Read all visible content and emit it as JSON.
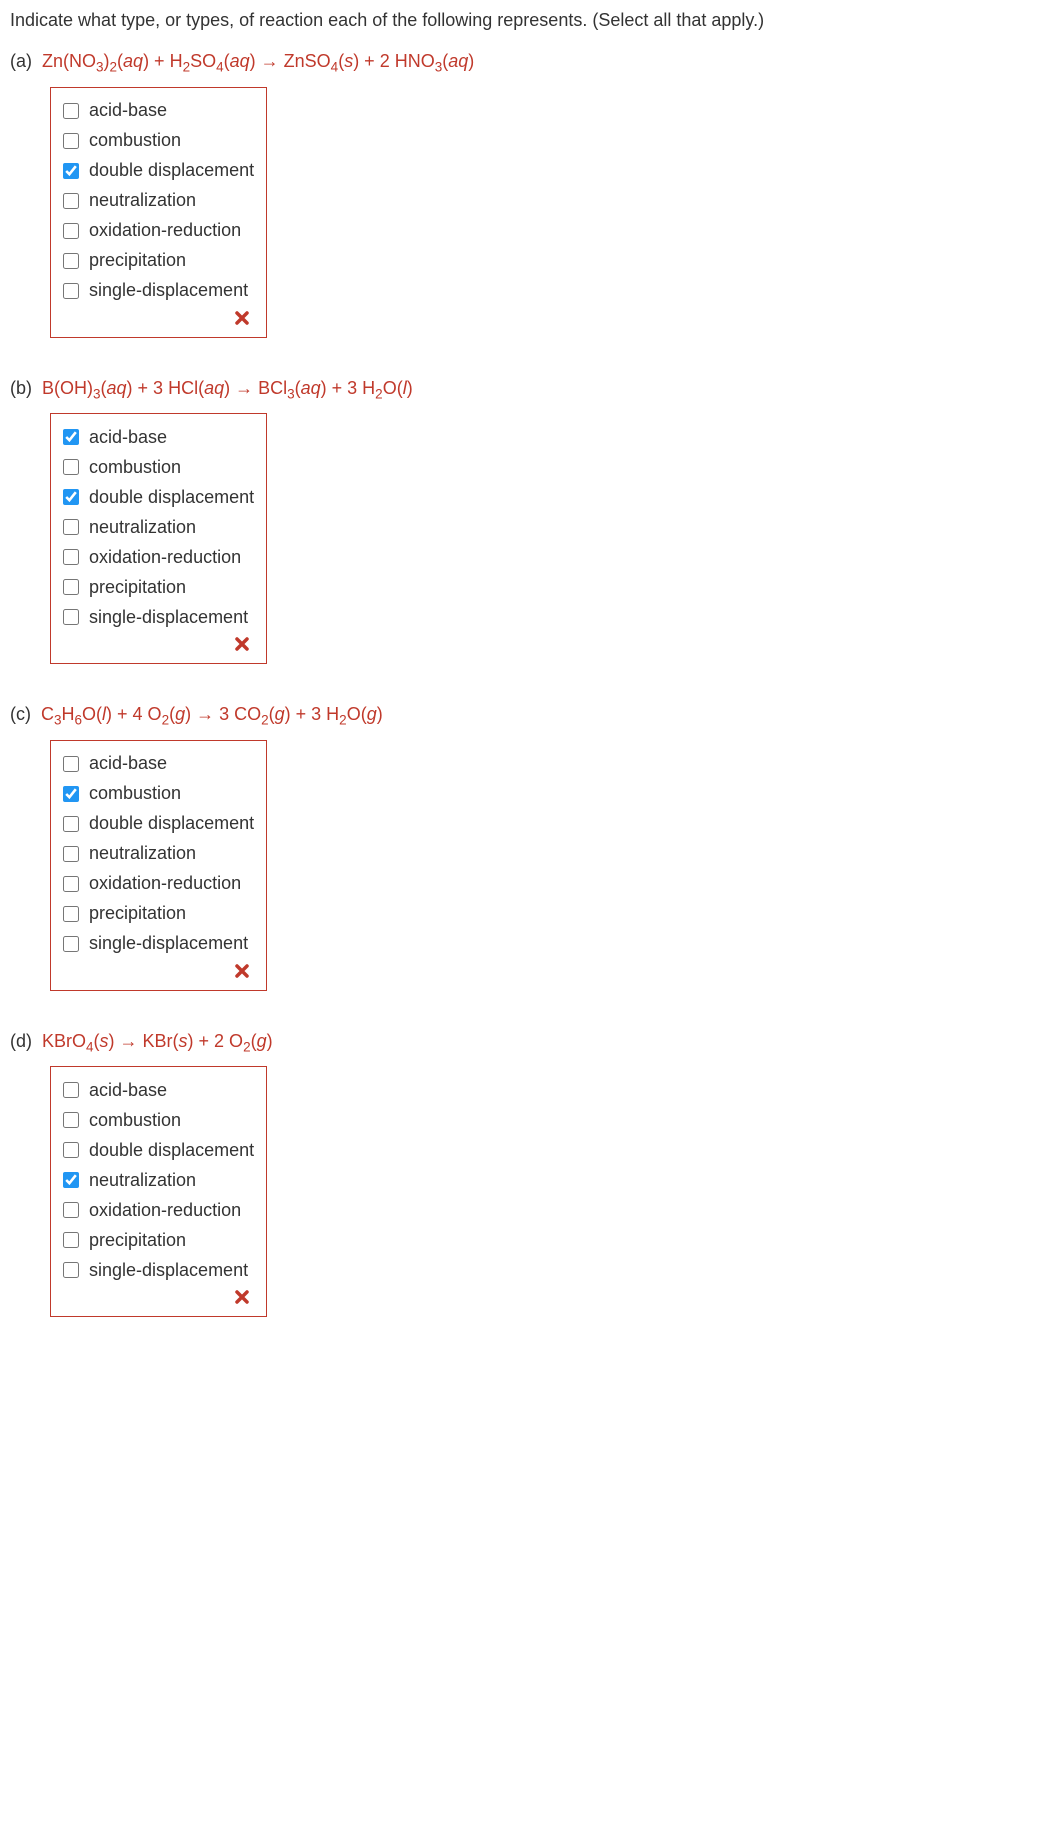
{
  "instruction": "Indicate what type, or types, of reaction each of the following represents. (Select all that apply.)",
  "options": [
    "acid-base",
    "combustion",
    "double displacement",
    "neutralization",
    "oxidation-reduction",
    "precipitation",
    "single-displacement"
  ],
  "questions": [
    {
      "part": "(a)",
      "equation_html": "Zn(NO<sub>3</sub>)<sub>2</sub>(<i>aq</i>) + H<sub>2</sub>SO<sub>4</sub>(<i>aq</i>) → ZnSO<sub>4</sub>(<i>s</i>) + 2 HNO<sub>3</sub>(<i>aq</i>)",
      "checked": [
        false,
        false,
        true,
        false,
        false,
        false,
        false
      ],
      "feedback": "incorrect"
    },
    {
      "part": "(b)",
      "equation_html": "B(OH)<sub>3</sub>(<i>aq</i>) + 3 HCl(<i>aq</i>) → BCl<sub>3</sub>(<i>aq</i>) + 3 H<sub>2</sub>O(<i>l</i>)",
      "checked": [
        true,
        false,
        true,
        false,
        false,
        false,
        false
      ],
      "feedback": "incorrect"
    },
    {
      "part": "(c)",
      "equation_html": "C<sub>3</sub>H<sub>6</sub>O(<i>l</i>) + 4 O<sub>2</sub>(<i>g</i>) → 3 CO<sub>2</sub>(<i>g</i>) + 3 H<sub>2</sub>O(<i>g</i>)",
      "checked": [
        false,
        true,
        false,
        false,
        false,
        false,
        false
      ],
      "feedback": "incorrect"
    },
    {
      "part": "(d)",
      "equation_html": "KBrO<sub>4</sub>(<i>s</i>) → KBr(<i>s</i>) + 2 O<sub>2</sub>(<i>g</i>)",
      "checked": [
        false,
        false,
        false,
        true,
        false,
        false,
        false
      ],
      "feedback": "incorrect"
    }
  ],
  "feedback_icon": "✖"
}
